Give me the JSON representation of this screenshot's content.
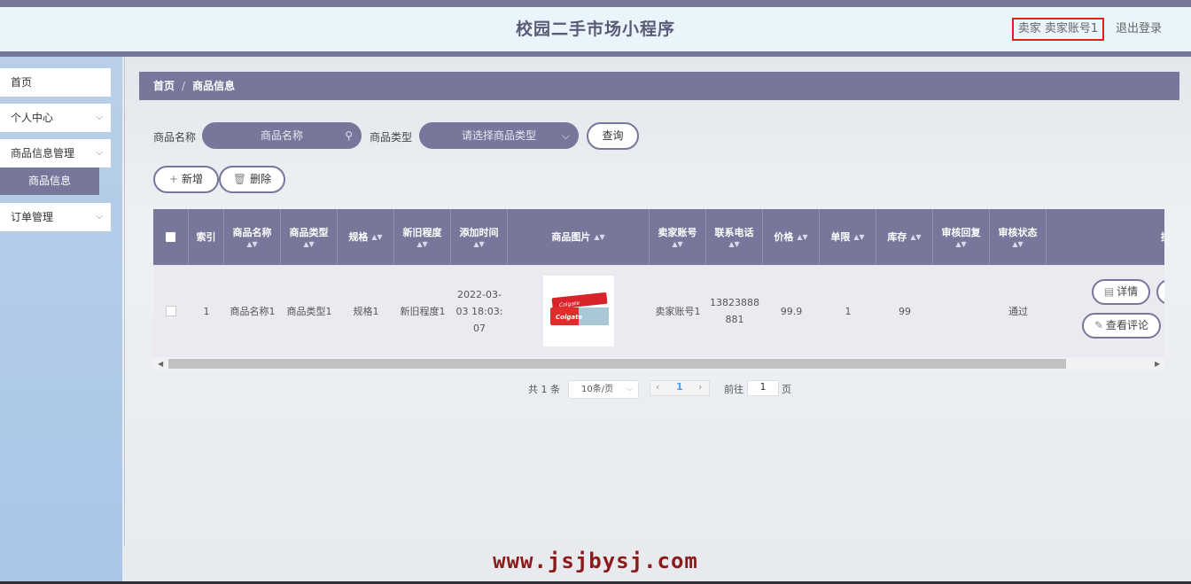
{
  "app": {
    "title": "校园二手市场小程序",
    "user_label": "卖家 卖家账号1",
    "logout": "退出登录"
  },
  "sidebar": {
    "items": [
      {
        "label": "首页",
        "chevron": ""
      },
      {
        "label": "个人中心",
        "chevron": "⌵"
      },
      {
        "label": "商品信息管理",
        "chevron": "⌵"
      },
      {
        "label": "订单管理",
        "chevron": "⌵"
      }
    ],
    "active_sub": "商品信息"
  },
  "breadcrumb": {
    "home": "首页",
    "sep": "/",
    "current": "商品信息"
  },
  "search": {
    "name_label": "商品名称",
    "name_placeholder": "商品名称",
    "type_label": "商品类型",
    "type_placeholder": "请选择商品类型",
    "query_button": "查询"
  },
  "toolbar": {
    "add": "新增",
    "delete": "删除"
  },
  "table": {
    "headers": [
      "索引",
      "商品名称",
      "商品类型",
      "规格",
      "新旧程度",
      "添加时间",
      "商品图片",
      "卖家账号",
      "联系电话",
      "价格",
      "单限",
      "库存",
      "审核回复",
      "审核状态",
      "操作"
    ],
    "rows": [
      {
        "index": "1",
        "name": "商品名称1",
        "type": "商品类型1",
        "spec": "规格1",
        "condition": "新旧程度1",
        "added": "2022-03-03 18:03:07",
        "image_alt": "Colgate",
        "seller": "卖家账号1",
        "phone": "13823888881",
        "price": "99.9",
        "limit": "1",
        "stock": "99",
        "review_reply": "",
        "review_status": "通过",
        "detail_btn": "详情",
        "comments_btn": "查看评论"
      }
    ]
  },
  "pager": {
    "total": "共 1 条",
    "page_size": "10条/页",
    "current": "1",
    "goto_label": "前往",
    "goto_value": "1",
    "page_unit": "页"
  },
  "watermark": "www.jsjbysj.com",
  "colors": {
    "accent": "#76779a",
    "header_bg": "#e9f4fb",
    "highlight_border": "#e02020"
  },
  "icons": {
    "search": "search-icon",
    "dropdown": "chevron-down-icon",
    "add": "plus-icon",
    "delete": "trash-icon",
    "detail": "document-icon",
    "comment": "edit-icon"
  }
}
